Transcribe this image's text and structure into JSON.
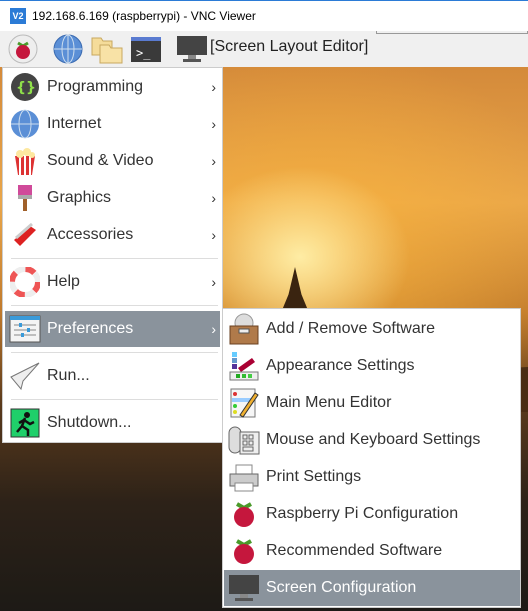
{
  "window": {
    "title": "192.168.6.169 (raspberrypi) - VNC Viewer",
    "logo": "V2"
  },
  "taskbar": {
    "active_window": "[Screen Layout Editor]",
    "icons": [
      "raspberry-icon",
      "globe-icon",
      "folder-icon",
      "terminal-icon",
      "monitor-icon"
    ]
  },
  "menu": {
    "items": [
      {
        "label": "Programming",
        "icon": "programming-icon"
      },
      {
        "label": "Internet",
        "icon": "globe-icon"
      },
      {
        "label": "Sound & Video",
        "icon": "popcorn-icon"
      },
      {
        "label": "Graphics",
        "icon": "paintbrush-icon"
      },
      {
        "label": "Accessories",
        "icon": "knife-icon"
      },
      {
        "label": "Help",
        "icon": "lifebuoy-icon"
      },
      {
        "label": "Preferences",
        "icon": "sliders-icon"
      },
      {
        "label": "Run...",
        "icon": "paper-plane-icon"
      },
      {
        "label": "Shutdown...",
        "icon": "exit-icon"
      }
    ],
    "arrow": "›"
  },
  "submenu": {
    "items": [
      {
        "label": "Add / Remove Software"
      },
      {
        "label": "Appearance Settings"
      },
      {
        "label": "Main Menu Editor"
      },
      {
        "label": "Mouse and Keyboard Settings"
      },
      {
        "label": "Print Settings"
      },
      {
        "label": "Raspberry Pi Configuration"
      },
      {
        "label": "Recommended Software"
      },
      {
        "label": "Screen Configuration"
      }
    ]
  },
  "colors": {
    "highlight": "#8a939c",
    "accent": "#2b7bd6"
  }
}
